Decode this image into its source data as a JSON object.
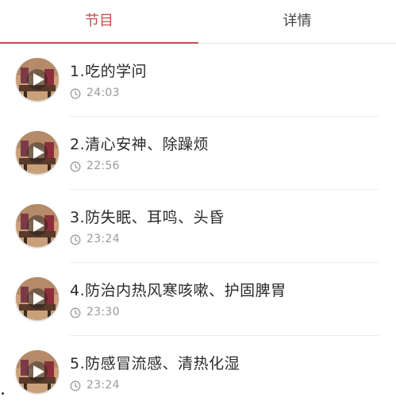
{
  "colors": {
    "accent": "#c0504d",
    "tab_inactive": "#444444",
    "play_bg": "rgba(40,40,40,0.55)"
  },
  "tabs": [
    {
      "label": "节目",
      "active": true
    },
    {
      "label": "详情",
      "active": false
    }
  ],
  "episodes": [
    {
      "title": "1.吃的学问",
      "duration": "24:03"
    },
    {
      "title": "2.清心安神、除躁烦",
      "duration": "22:56"
    },
    {
      "title": "3.防失眠、耳鸣、头昏",
      "duration": "23:24"
    },
    {
      "title": "4.防治内热风寒咳嗽、护固脾胃",
      "duration": "23:30"
    },
    {
      "title": "5.防感冒流感、清热化湿",
      "duration": "23:24"
    }
  ],
  "icons": {
    "thumbnail": "play-thumbnail-icon",
    "clock": "clock-icon"
  }
}
